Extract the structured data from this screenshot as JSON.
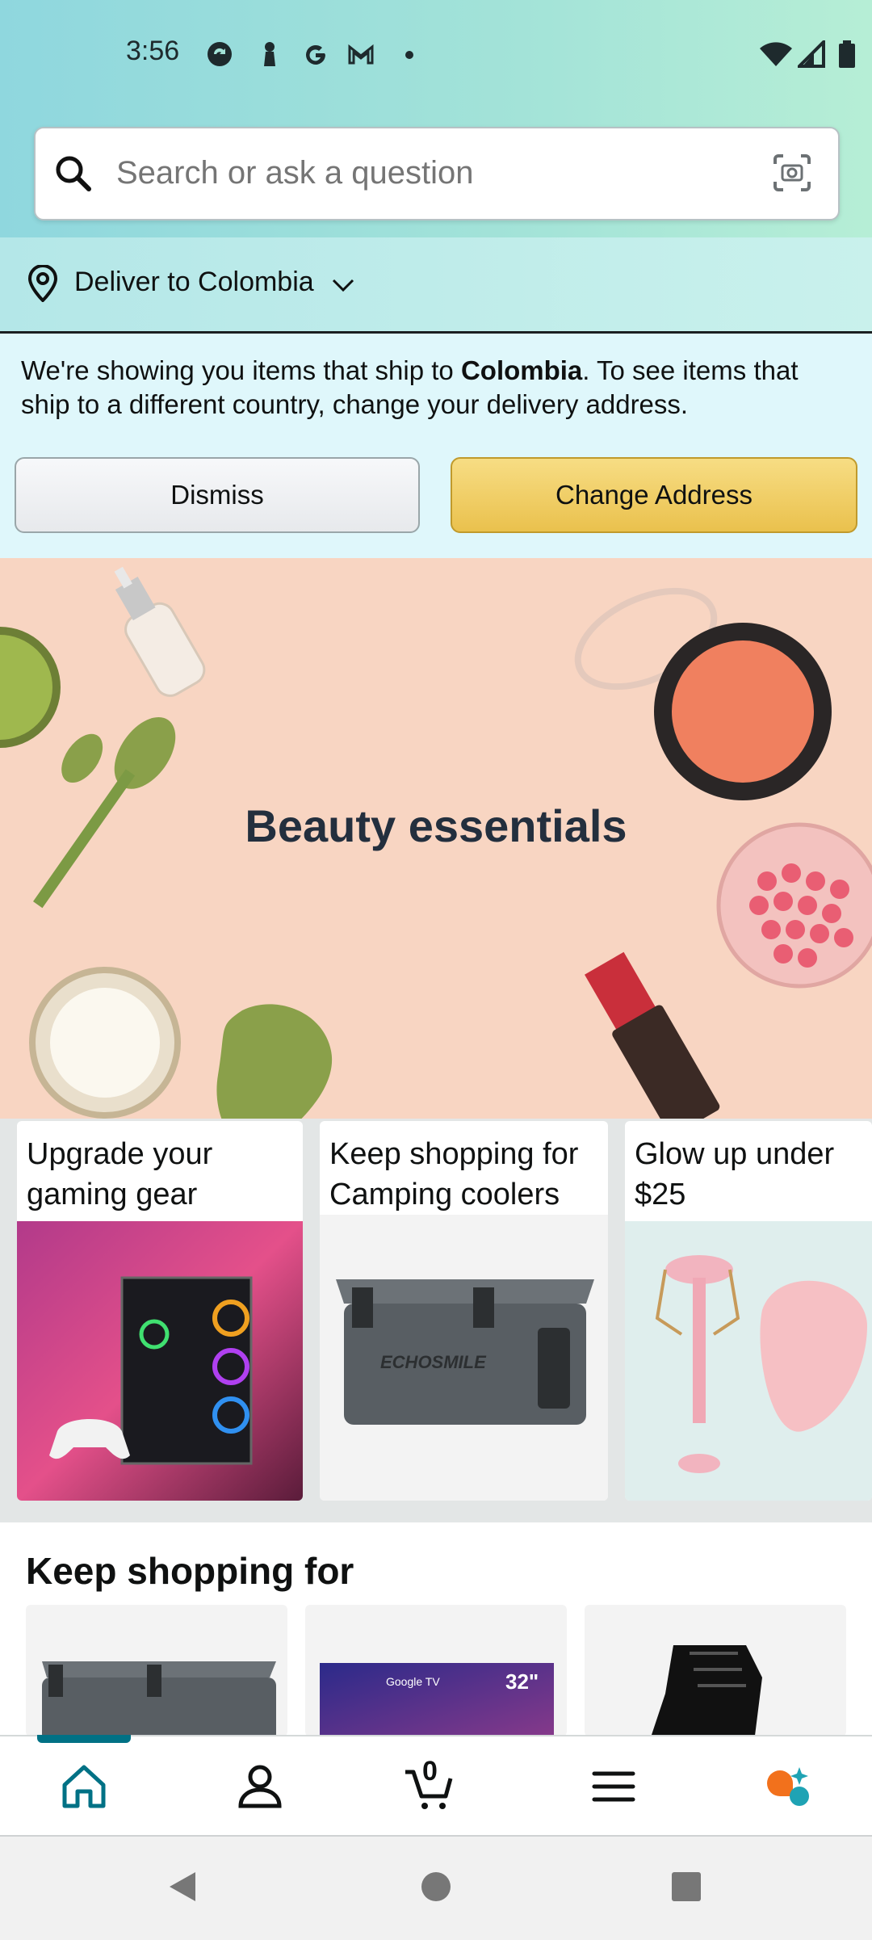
{
  "status_bar": {
    "time": "3:56"
  },
  "search": {
    "placeholder": "Search or ask a question"
  },
  "deliver": {
    "label": "Deliver to Colombia"
  },
  "notice": {
    "text_before": "We're showing you items that ship to ",
    "country": "Colombia",
    "text_after": ". To see items that ship to a different country, change your delivery address.",
    "dismiss_label": "Dismiss",
    "change_label": "Change Address"
  },
  "hero": {
    "title": "Beauty essentials"
  },
  "cards": [
    {
      "title": "Upgrade your gaming gear"
    },
    {
      "title": "Keep shopping for Camping coolers"
    },
    {
      "title": "Glow up under $25"
    }
  ],
  "keep_shopping": {
    "title": "Keep shopping for",
    "tv_badge": "Google TV",
    "tv_size": "32\""
  },
  "bottom_nav": {
    "items": [
      "home-icon",
      "account-icon",
      "cart-icon",
      "menu-icon",
      "rufus-icon"
    ],
    "cart_count": "0",
    "accent": "#007185"
  },
  "colors": {
    "change_button": "#f0c14b",
    "header": "#a3e3d8"
  }
}
